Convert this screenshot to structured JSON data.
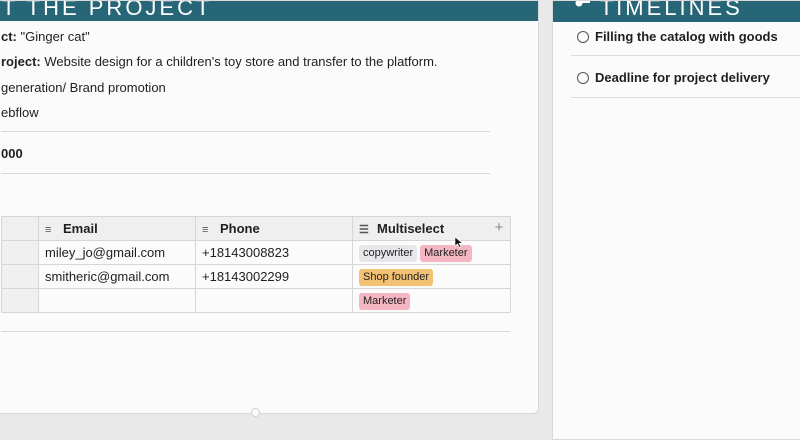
{
  "about": {
    "header_title": "UT THE PROJECT",
    "client_label": "ct:",
    "client_value": "\"Ginger cat\"",
    "project_label": "roject:",
    "project_value": "Website design for a children's toy store and transfer to the platform.",
    "goals_text": "generation/ Brand promotion",
    "platform_text": "ebflow",
    "budget_text": "000"
  },
  "table": {
    "columns": [
      {
        "label": "Email",
        "icon": "text-lines-icon"
      },
      {
        "label": "Phone",
        "icon": "text-lines-icon"
      },
      {
        "label": "Multiselect",
        "icon": "list-icon"
      }
    ],
    "add_column_label": "+",
    "rows": [
      {
        "email": "miley_jo@gmail.com",
        "phone": "+18143008823",
        "tags": [
          "copywriter",
          "Marketer"
        ]
      },
      {
        "email": "smitheric@gmail.com",
        "phone": "+18143002299",
        "tags": [
          "Shop founder"
        ]
      },
      {
        "email": "",
        "phone": "",
        "tags": [
          "Marketer"
        ]
      }
    ]
  },
  "timelines": {
    "header_title": "TIMELINES",
    "items": [
      {
        "label": "Filling the catalog with goods"
      },
      {
        "label": "Deadline for project delivery"
      }
    ]
  },
  "colors": {
    "header_bg": "#276677",
    "tag_copywriter": "#e6e7ea",
    "tag_marketer": "#f4b6c2",
    "tag_founder": "#f2c173"
  }
}
